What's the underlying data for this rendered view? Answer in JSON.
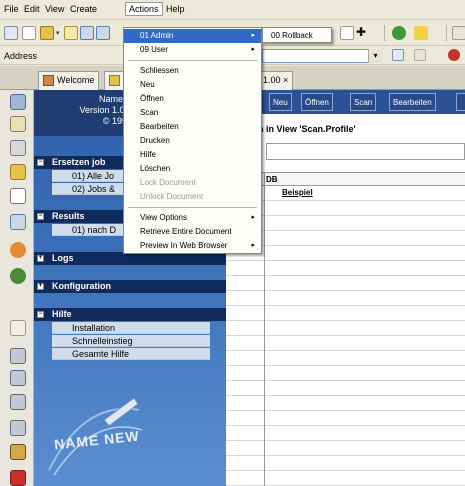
{
  "menubar": [
    {
      "label": "File"
    },
    {
      "label": "Edit"
    },
    {
      "label": "View"
    },
    {
      "label": "Create"
    },
    {
      "label": "Actions"
    },
    {
      "label": "Help"
    }
  ],
  "address": {
    "label": "Address",
    "value": ""
  },
  "tabs": [
    {
      "label": "Welcome"
    },
    {
      "label": "1.00 ×"
    }
  ],
  "nav": {
    "header_lines": [
      "Name.C",
      "Version 1.00,",
      "© 1999"
    ],
    "sections": [
      {
        "title": "Ersetzen job",
        "items": [
          "01) Alle Jo",
          "02) Jobs &"
        ]
      },
      {
        "title": "Results",
        "items": [
          "01) nach D"
        ]
      },
      {
        "title": "Logs",
        "items": []
      },
      {
        "title": "Konfiguration",
        "items": []
      },
      {
        "title": "Hilfe",
        "items": [
          "Installation",
          "Schnelleinstieg",
          "Gesamte Hilfe"
        ]
      }
    ],
    "logo_text": "NAME NEW"
  },
  "content": {
    "action_buttons": [
      "Neu",
      "Öffnen",
      "Scan",
      "Bearbeiten"
    ],
    "view_title": "n in View 'Scan.Profile'",
    "column_header": "DB",
    "first_row": "Beispiel"
  },
  "actions_menu": {
    "items": [
      {
        "label": "01 Admin",
        "submenu": true,
        "highlighted": true
      },
      {
        "label": "09 User",
        "submenu": true
      },
      {
        "sep": true
      },
      {
        "label": "Schliessen"
      },
      {
        "label": "Neu"
      },
      {
        "label": "Öffnen"
      },
      {
        "label": "Scan"
      },
      {
        "label": "Bearbeiten"
      },
      {
        "label": "Drucken"
      },
      {
        "label": "Hilfe"
      },
      {
        "label": "Löschen"
      },
      {
        "label": "Lock Document",
        "disabled": true
      },
      {
        "label": "Unlock Document",
        "disabled": true
      },
      {
        "sep": true
      },
      {
        "label": "View Options",
        "submenu": true
      },
      {
        "label": "Retrieve Entire Document"
      },
      {
        "label": "Preview In Web Browser",
        "submenu": true
      }
    ]
  },
  "admin_submenu": {
    "items": [
      {
        "label": "00 Rollback"
      }
    ]
  }
}
